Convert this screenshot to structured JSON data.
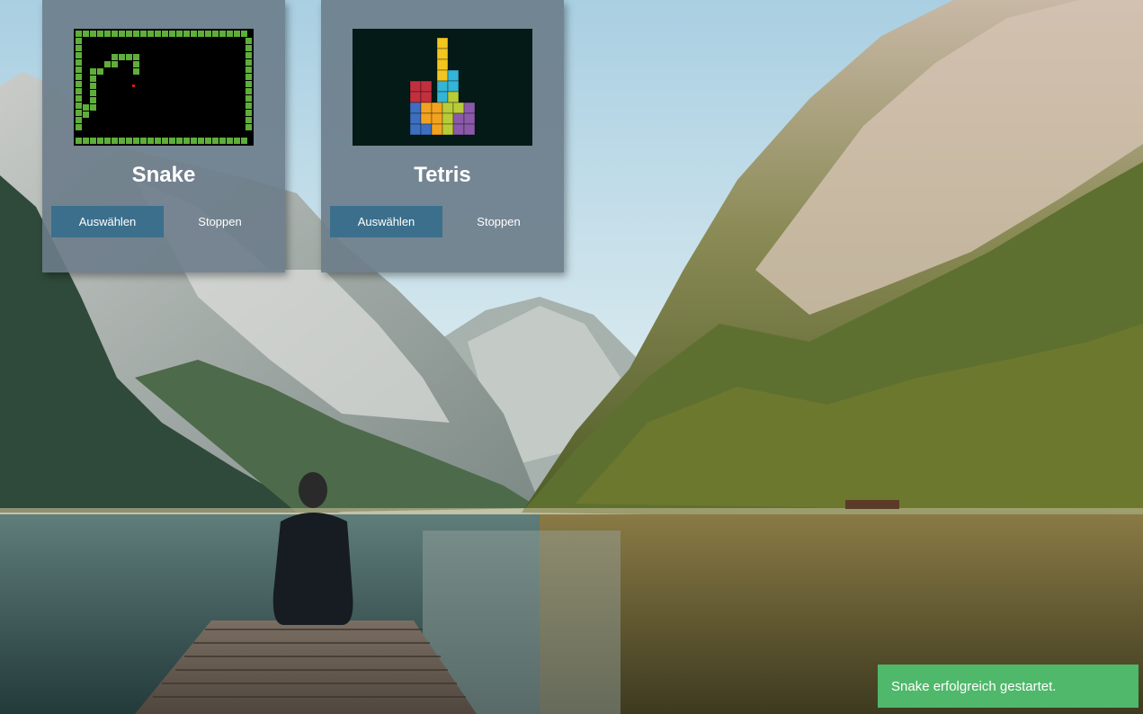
{
  "games": [
    {
      "title": "Snake",
      "select_label": "Auswählen",
      "stop_label": "Stoppen"
    },
    {
      "title": "Tetris",
      "select_label": "Auswählen",
      "stop_label": "Stoppen"
    }
  ],
  "notification": {
    "message": "Snake erfolgreich gestartet."
  },
  "colors": {
    "card_bg": "#6c7c8a",
    "select_button": "#3b6f8c",
    "toast_success": "#4fb86a",
    "snake_green": "#5fae3a",
    "snake_food": "#c81e1e"
  }
}
